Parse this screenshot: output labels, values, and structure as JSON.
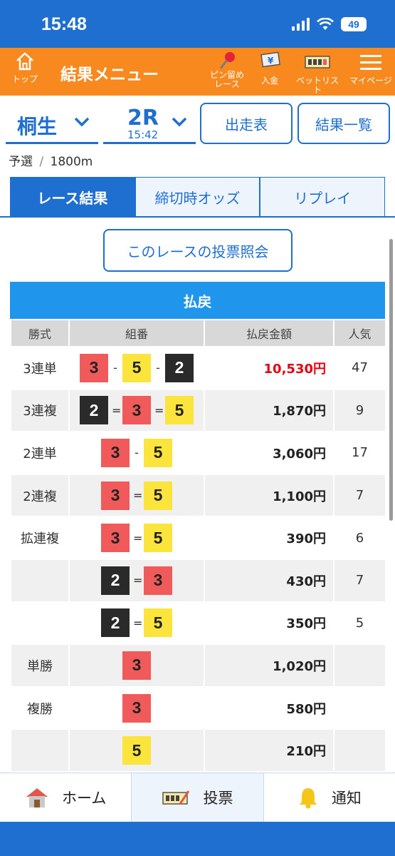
{
  "status": {
    "time": "15:48",
    "battery": "49"
  },
  "header": {
    "title": "結果メニュー",
    "top_label": "トップ",
    "pin_label_1": "ピン留め",
    "pin_label_2": "レース",
    "deposit_label": "入金",
    "betlist_label": "ベットリスト",
    "mypage_label": "マイページ"
  },
  "race": {
    "venue": "桐生",
    "race_no": "2R",
    "race_time": "15:42",
    "entry_button": "出走表",
    "results_button": "結果一覧",
    "class": "予選",
    "separator": "/",
    "distance": "1800m"
  },
  "tabs": [
    "レース結果",
    "締切時オッズ",
    "リプレイ"
  ],
  "bet_query_button": "このレースの投票照会",
  "payout": {
    "title": "払戻",
    "headers": [
      "勝式",
      "組番",
      "払戻金額",
      "人気"
    ],
    "rows": [
      {
        "kind": "3連単",
        "boats": [
          3,
          5,
          2
        ],
        "sep": "-",
        "amount": "10,530円",
        "pop": "47",
        "highlight": true
      },
      {
        "kind": "3連複",
        "boats": [
          2,
          3,
          5
        ],
        "sep": "=",
        "amount": "1,870円",
        "pop": "9",
        "highlight": false
      },
      {
        "kind": "2連単",
        "boats": [
          3,
          5
        ],
        "sep": "-",
        "amount": "3,060円",
        "pop": "17",
        "highlight": false
      },
      {
        "kind": "2連複",
        "boats": [
          3,
          5
        ],
        "sep": "=",
        "amount": "1,100円",
        "pop": "7",
        "highlight": false
      },
      {
        "kind": "拡連複",
        "boats": [
          3,
          5
        ],
        "sep": "=",
        "amount": "390円",
        "pop": "6",
        "highlight": false
      },
      {
        "kind": "",
        "boats": [
          2,
          3
        ],
        "sep": "=",
        "amount": "430円",
        "pop": "7",
        "highlight": false
      },
      {
        "kind": "",
        "boats": [
          2,
          5
        ],
        "sep": "=",
        "amount": "350円",
        "pop": "5",
        "highlight": false
      },
      {
        "kind": "単勝",
        "boats": [
          3
        ],
        "sep": "",
        "amount": "1,020円",
        "pop": "",
        "highlight": false
      },
      {
        "kind": "複勝",
        "boats": [
          3
        ],
        "sep": "",
        "amount": "580円",
        "pop": "",
        "highlight": false
      },
      {
        "kind": "",
        "boats": [
          5
        ],
        "sep": "",
        "amount": "210円",
        "pop": "",
        "highlight": false
      }
    ]
  },
  "bottom_nav": {
    "home": "ホーム",
    "vote": "投票",
    "notice": "通知"
  }
}
